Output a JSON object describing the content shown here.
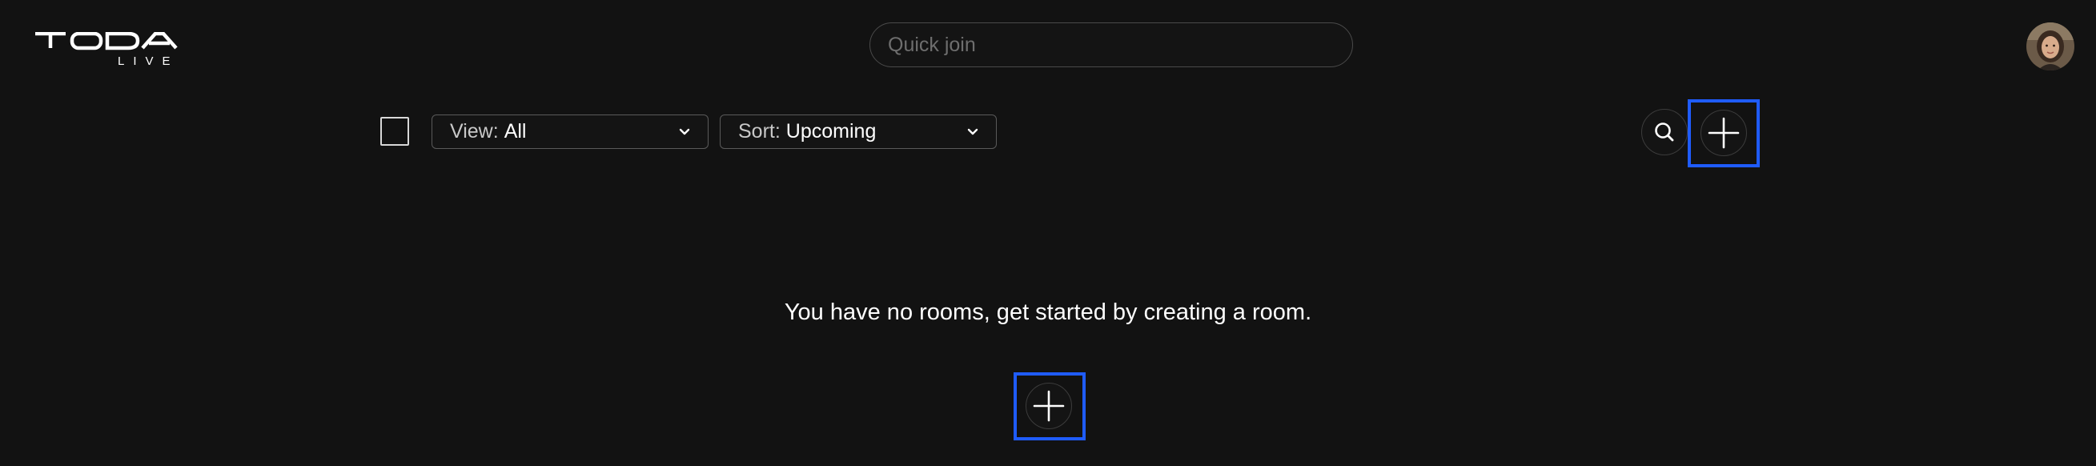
{
  "brand": {
    "logo_text": "TODA",
    "logo_subtext": "LIVE"
  },
  "header": {
    "quick_join_placeholder": "Quick join",
    "quick_join_value": "",
    "avatar_icon": "user-avatar"
  },
  "toolbar": {
    "view_prefix": "View:",
    "view_value": "All",
    "sort_prefix": "Sort:",
    "sort_value": "Upcoming",
    "search_icon": "search-icon",
    "add_icon": "plus-icon"
  },
  "main": {
    "empty_message": "You have no rooms, get started by creating a room."
  },
  "colors": {
    "background": "#121212",
    "highlight": "#1f5cff",
    "text": "#ffffff"
  }
}
